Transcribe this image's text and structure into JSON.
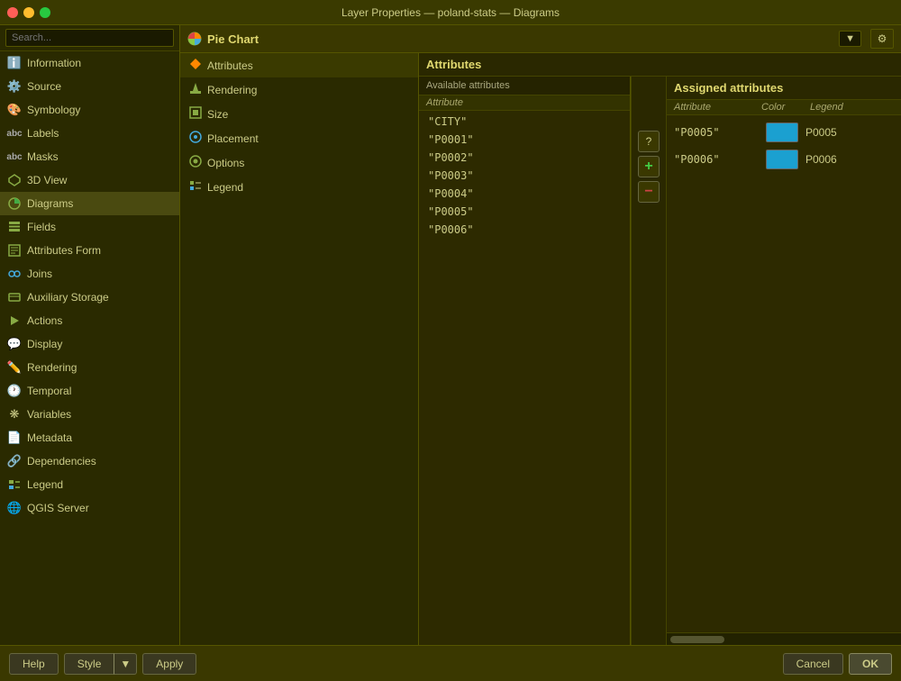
{
  "titlebar": {
    "title": "Layer Properties — poland-stats — Diagrams"
  },
  "sidebar": {
    "search_placeholder": "Search...",
    "items": [
      {
        "id": "information",
        "label": "Information",
        "icon": "ℹ"
      },
      {
        "id": "source",
        "label": "Source",
        "icon": "⚙"
      },
      {
        "id": "symbology",
        "label": "Symbology",
        "icon": "🎨"
      },
      {
        "id": "labels",
        "label": "Labels",
        "icon": "abc"
      },
      {
        "id": "masks",
        "label": "Masks",
        "icon": "abc"
      },
      {
        "id": "3dview",
        "label": "3D View",
        "icon": "◈"
      },
      {
        "id": "diagrams",
        "label": "Diagrams",
        "icon": "◉",
        "active": true
      },
      {
        "id": "fields",
        "label": "Fields",
        "icon": "▦"
      },
      {
        "id": "attributes-form",
        "label": "Attributes Form",
        "icon": "▤"
      },
      {
        "id": "joins",
        "label": "Joins",
        "icon": "⋈"
      },
      {
        "id": "auxiliary-storage",
        "label": "Auxiliary Storage",
        "icon": "🗄"
      },
      {
        "id": "actions",
        "label": "Actions",
        "icon": "▶"
      },
      {
        "id": "display",
        "label": "Display",
        "icon": "💬"
      },
      {
        "id": "rendering",
        "label": "Rendering",
        "icon": "✏"
      },
      {
        "id": "temporal",
        "label": "Temporal",
        "icon": "🕐"
      },
      {
        "id": "variables",
        "label": "Variables",
        "icon": "❋"
      },
      {
        "id": "metadata",
        "label": "Metadata",
        "icon": "📄"
      },
      {
        "id": "dependencies",
        "label": "Dependencies",
        "icon": "🔗"
      },
      {
        "id": "legend",
        "label": "Legend",
        "icon": "▤"
      },
      {
        "id": "qgis-server",
        "label": "QGIS Server",
        "icon": "🌐"
      }
    ]
  },
  "diagram_type": "Pie Chart",
  "middle_menu": {
    "items": [
      {
        "id": "attributes",
        "label": "Attributes",
        "icon": "◈",
        "active": true
      },
      {
        "id": "rendering",
        "label": "Rendering",
        "icon": "✏"
      },
      {
        "id": "size",
        "label": "Size",
        "icon": "▦"
      },
      {
        "id": "placement",
        "label": "Placement",
        "icon": "◎"
      },
      {
        "id": "options",
        "label": "Options",
        "icon": "⚙"
      },
      {
        "id": "legend",
        "label": "Legend",
        "icon": "▤"
      }
    ]
  },
  "attributes_panel": {
    "title": "Attributes",
    "available_label": "Available attributes",
    "assigned_label": "Assigned attributes",
    "column_attribute": "Attribute",
    "column_color": "Color",
    "column_legend": "Legend",
    "available_items": [
      "\"CITY\"",
      "\"P0001\"",
      "\"P0002\"",
      "\"P0003\"",
      "\"P0004\"",
      "\"P0005\"",
      "\"P0006\""
    ],
    "assigned_items": [
      {
        "attribute": "\"P0005\"",
        "color": "#1ba0d0",
        "legend": "P0005"
      },
      {
        "attribute": "\"P0006\"",
        "color": "#1ba0d0",
        "legend": "P0006"
      }
    ]
  },
  "buttons": {
    "help": "Help",
    "style": "Style",
    "style_dropdown": "▼",
    "apply": "Apply",
    "cancel": "Cancel",
    "ok": "OK"
  },
  "icons": {
    "question": "?",
    "add": "+",
    "remove": "−",
    "pie": "🥧"
  }
}
